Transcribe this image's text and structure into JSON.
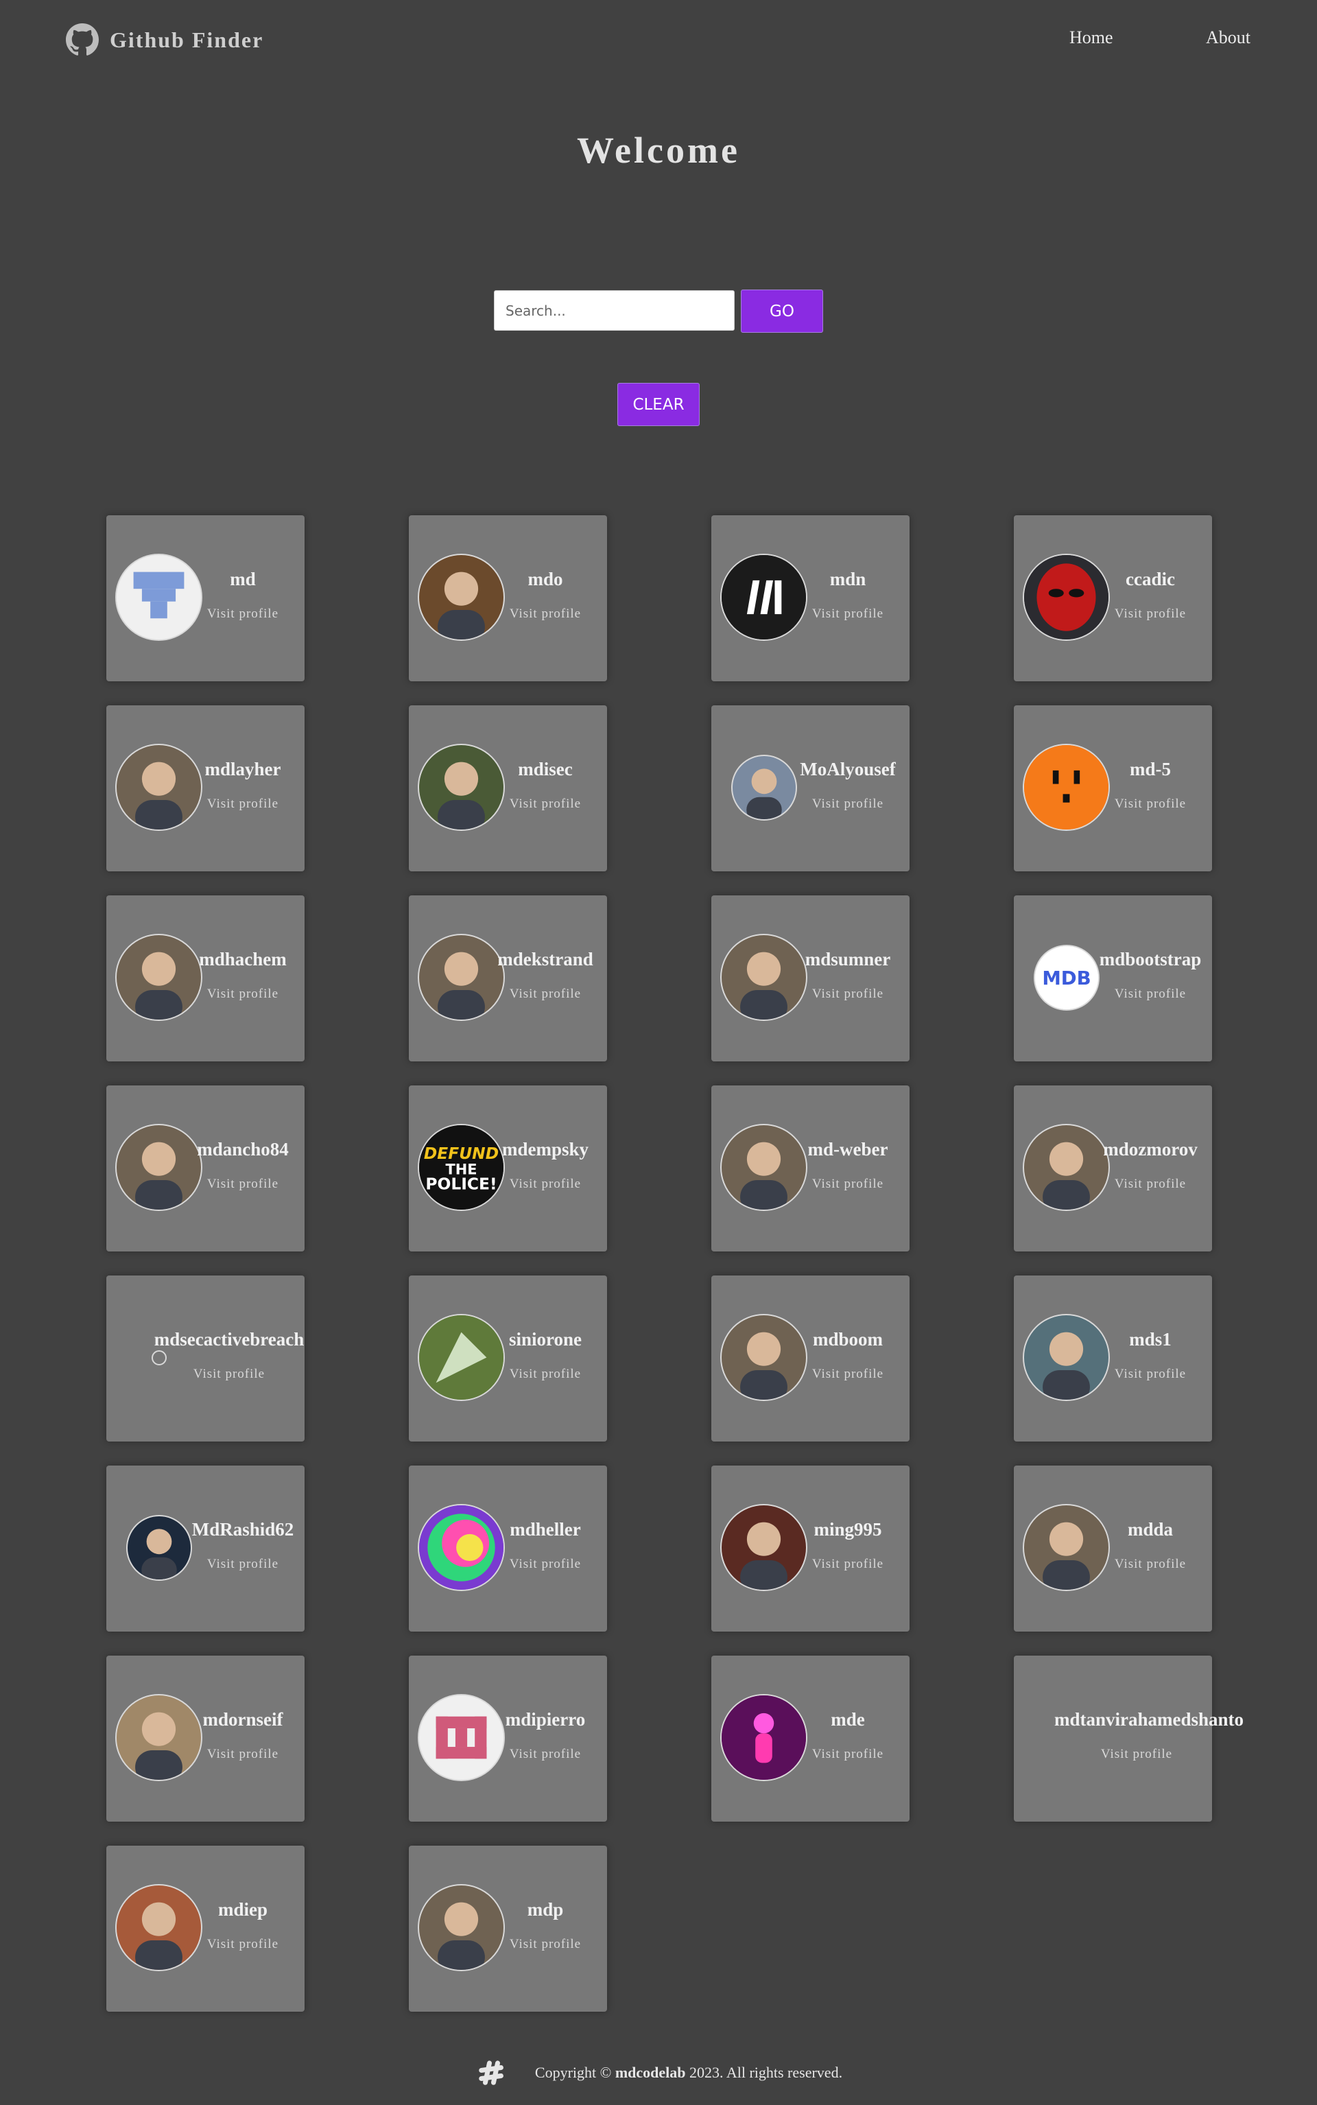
{
  "nav": {
    "brand": "Github Finder",
    "brand_icon": "github-icon",
    "links": [
      "Home",
      "About"
    ]
  },
  "hero": {
    "title": "Welcome"
  },
  "search": {
    "placeholder": "Search...",
    "go_label": "GO",
    "clear_label": "CLEAR"
  },
  "accent_color": "#8a2be2",
  "users": [
    {
      "login": "md",
      "link": "Visit profile",
      "avatar": "identicon-blue"
    },
    {
      "login": "mdo",
      "link": "Visit profile",
      "avatar": "photo-bearded-man"
    },
    {
      "login": "mdn",
      "link": "Visit profile",
      "avatar": "mdn-logo"
    },
    {
      "login": "ccadic",
      "link": "Visit profile",
      "avatar": "red-mask"
    },
    {
      "login": "mdlayher",
      "link": "Visit profile",
      "avatar": "photo-man"
    },
    {
      "login": "mdisec",
      "link": "Visit profile",
      "avatar": "photo-man-beanie"
    },
    {
      "login": "MoAlyousef",
      "link": "Visit profile",
      "avatar": "photo-landscape"
    },
    {
      "login": "md-5",
      "link": "Visit profile",
      "avatar": "orange-outlet"
    },
    {
      "login": "mdhachem",
      "link": "Visit profile",
      "avatar": "photo-man"
    },
    {
      "login": "mdekstrand",
      "link": "Visit profile",
      "avatar": "photo-man"
    },
    {
      "login": "mdsumner",
      "link": "Visit profile",
      "avatar": "photo-man"
    },
    {
      "login": "mdbootstrap",
      "link": "Visit profile",
      "avatar": "mdb-logo"
    },
    {
      "login": "mdancho84",
      "link": "Visit profile",
      "avatar": "photo-man"
    },
    {
      "login": "mdempsky",
      "link": "Visit profile",
      "avatar": "defund-the-police"
    },
    {
      "login": "md-weber",
      "link": "Visit profile",
      "avatar": "photo-man"
    },
    {
      "login": "mdozmorov",
      "link": "Visit profile",
      "avatar": "photo-man"
    },
    {
      "login": "mdsecactivebreach",
      "link": "Visit profile",
      "avatar": "tiny-logo"
    },
    {
      "login": "siniorone",
      "link": "Visit profile",
      "avatar": "green-hacker"
    },
    {
      "login": "mdboom",
      "link": "Visit profile",
      "avatar": "photo-man"
    },
    {
      "login": "mds1",
      "link": "Visit profile",
      "avatar": "photo-outdoors"
    },
    {
      "login": "MdRashid62",
      "link": "Visit profile",
      "avatar": "dark-scene"
    },
    {
      "login": "mdheller",
      "link": "Visit profile",
      "avatar": "rainbow-swirl"
    },
    {
      "login": "ming995",
      "link": "Visit profile",
      "avatar": "motorbike"
    },
    {
      "login": "mdda",
      "link": "Visit profile",
      "avatar": "photo-man"
    },
    {
      "login": "mdornseif",
      "link": "Visit profile",
      "avatar": "old-car"
    },
    {
      "login": "mdipierro",
      "link": "Visit profile",
      "avatar": "pink-identicon"
    },
    {
      "login": "mde",
      "link": "Visit profile",
      "avatar": "neon-figure"
    },
    {
      "login": "mdtanvirahamedshanto",
      "link": "Visit profile",
      "avatar": "tiny-dot"
    },
    {
      "login": "mdiep",
      "link": "Visit profile",
      "avatar": "photo-man-glasses"
    },
    {
      "login": "mdp",
      "link": "Visit profile",
      "avatar": "photo-man"
    }
  ],
  "footer": {
    "icon": "hashtag-icon",
    "copyright_prefix": "Copyright © ",
    "owner": "mdcodelab",
    "copyright_suffix": " 2023. All rights reserved."
  }
}
